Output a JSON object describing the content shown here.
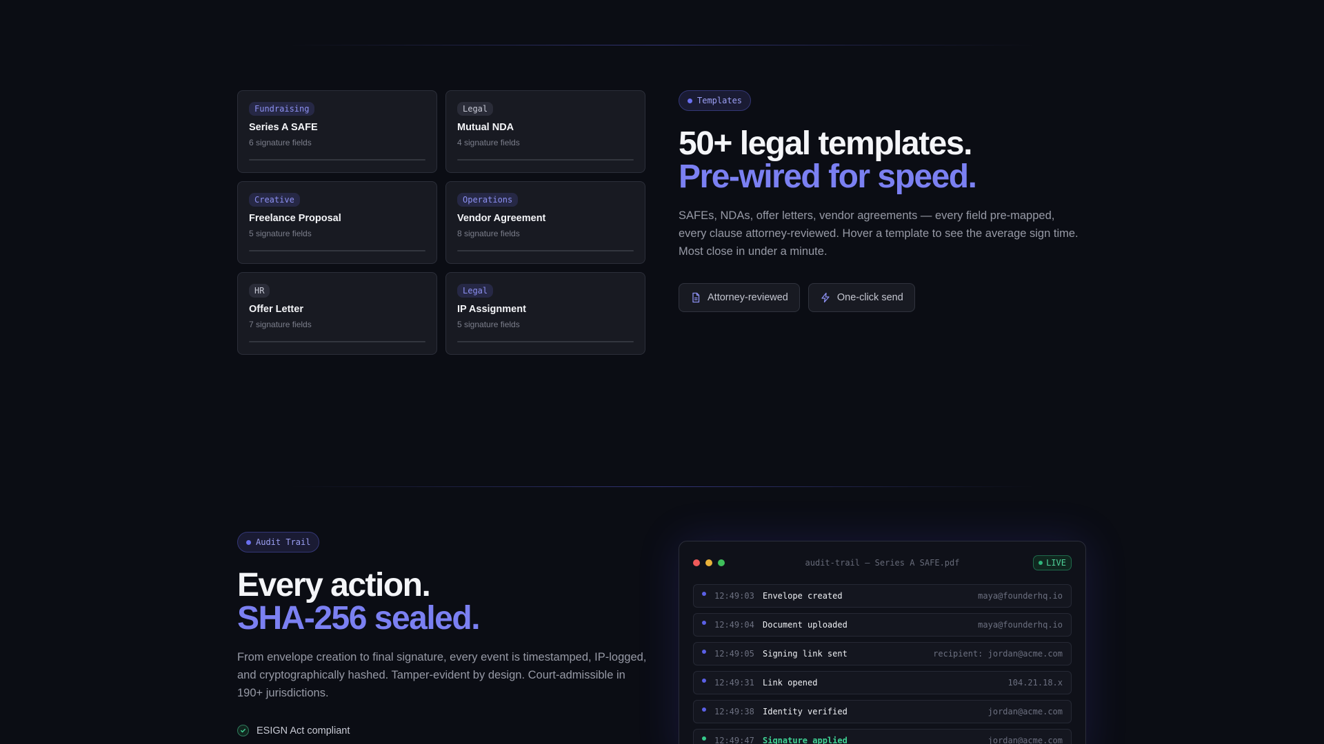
{
  "templates": {
    "cards": [
      {
        "tag": "Fundraising",
        "title": "Series A SAFE",
        "fields": "6 signature fields"
      },
      {
        "tag": "Legal",
        "title": "Mutual NDA",
        "fields": "4 signature fields"
      },
      {
        "tag": "Creative",
        "title": "Freelance Proposal",
        "fields": "5 signature fields"
      },
      {
        "tag": "Operations",
        "title": "Vendor Agreement",
        "fields": "8 signature fields"
      },
      {
        "tag": "HR",
        "title": "Offer Letter",
        "fields": "7 signature fields"
      },
      {
        "tag": "Legal",
        "title": "IP Assignment",
        "fields": "5 signature fields"
      }
    ],
    "pill": "Templates",
    "headline_1": "50+ legal templates.",
    "headline_2": "Pre-wired for speed.",
    "lede": "SAFEs, NDAs, offer letters, vendor agreements — every field pre-mapped, every clause attorney-reviewed. Hover a template to see the average sign time. Most close in under a minute.",
    "chips": [
      {
        "label": "Attorney-reviewed",
        "icon": "document-icon"
      },
      {
        "label": "One-click send",
        "icon": "lightning-icon"
      }
    ]
  },
  "audit": {
    "pill": "Audit Trail",
    "headline_1": "Every action.",
    "headline_2": "SHA-256 sealed.",
    "lede": "From envelope creation to final signature, every event is timestamped, IP-logged, and cryptographically hashed. Tamper-evident by design. Court-admissible in 190+ jurisdictions.",
    "checks": [
      "ESIGN Act compliant"
    ],
    "terminal": {
      "title": "audit-trail — Series A SAFE.pdf",
      "live": "LIVE",
      "rows": [
        {
          "time": "12:49:03",
          "event": "Envelope created",
          "meta": "maya@founderhq.io"
        },
        {
          "time": "12:49:04",
          "event": "Document uploaded",
          "meta": "maya@founderhq.io"
        },
        {
          "time": "12:49:05",
          "event": "Signing link sent",
          "meta": "recipient: jordan@acme.com"
        },
        {
          "time": "12:49:31",
          "event": "Link opened",
          "meta": "104.21.18.x"
        },
        {
          "time": "12:49:38",
          "event": "Identity verified",
          "meta": "jordan@acme.com"
        },
        {
          "time": "12:49:47",
          "event": "Signature applied",
          "meta": "jordan@acme.com"
        }
      ]
    }
  },
  "colors": {
    "accent": "#7b80f2",
    "background": "#0b0d14",
    "success": "#3fd394"
  }
}
